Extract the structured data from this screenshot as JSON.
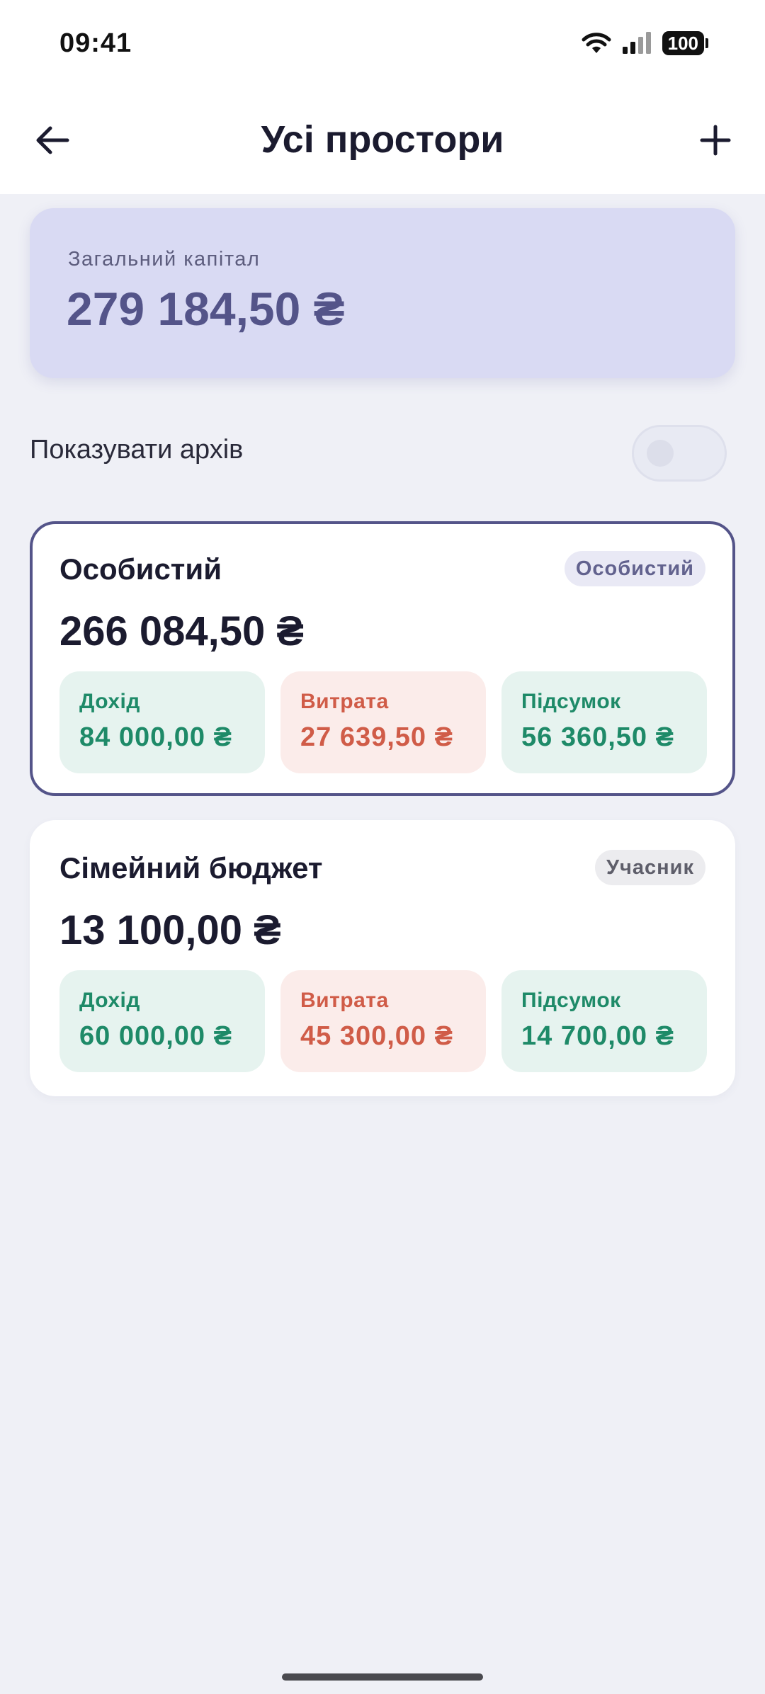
{
  "status_bar": {
    "time": "09:41",
    "battery": "100"
  },
  "header": {
    "title": "Усі простори"
  },
  "capital": {
    "label": "Загальний капітал",
    "value": "279 184,50 ₴"
  },
  "archive": {
    "label": "Показувати архів",
    "enabled": false
  },
  "spaces": [
    {
      "name": "Особистий",
      "role": "Особистий",
      "total": "266 084,50 ₴",
      "income_label": "Дохід",
      "income": "84 000,00 ₴",
      "expense_label": "Витрата",
      "expense": "27 639,50 ₴",
      "summary_label": "Підсумок",
      "summary": "56 360,50 ₴"
    },
    {
      "name": "Сімейний бюджет",
      "role": "Учасник",
      "total": "13 100,00 ₴",
      "income_label": "Дохід",
      "income": "60 000,00 ₴",
      "expense_label": "Витрата",
      "expense": "45 300,00 ₴",
      "summary_label": "Підсумок",
      "summary": "14 700,00 ₴"
    }
  ],
  "colors": {
    "accent": "#545489",
    "income": "#1E8A68",
    "expense": "#D05C48",
    "background": "#EFF0F6"
  }
}
